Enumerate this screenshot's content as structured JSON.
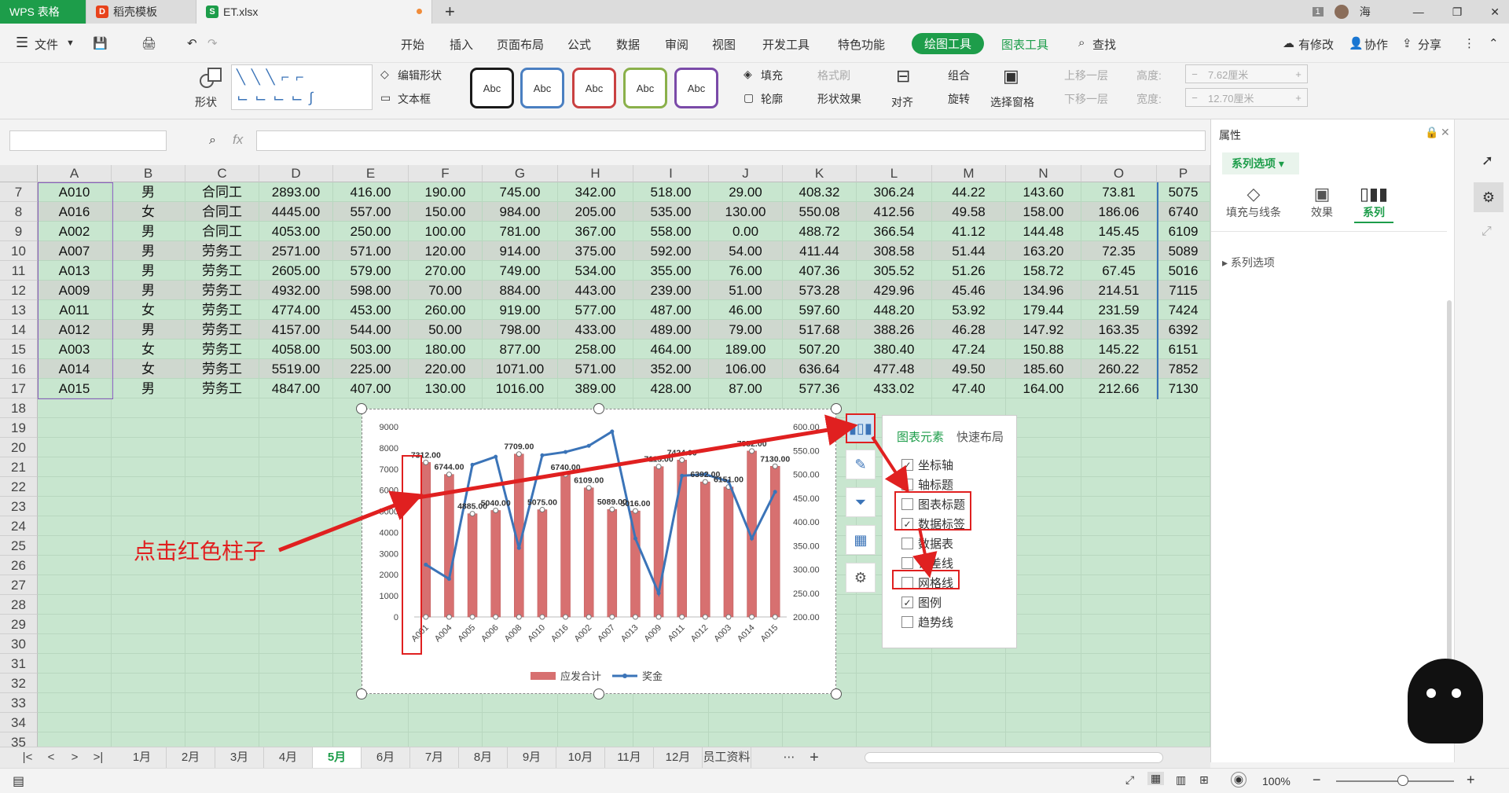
{
  "tabs": [
    {
      "label": "WPS 表格",
      "logo_color": "#c0392b"
    },
    {
      "label": "稻壳模板",
      "logo_color": "#e8421b"
    },
    {
      "label": "ET.xlsx",
      "logo_color": "#1d9d4a"
    }
  ],
  "title_area": {
    "badge": "1",
    "user": "海"
  },
  "menu": {
    "file": "文件",
    "items": [
      "开始",
      "插入",
      "页面布局",
      "公式",
      "数据",
      "审阅",
      "视图",
      "开发工具",
      "特色功能"
    ],
    "drawing_tools": "绘图工具",
    "chart_tools": "图表工具",
    "search": "查找",
    "modified": "有修改",
    "collab": "协作",
    "share": "分享"
  },
  "ribbon": {
    "shape": "形状",
    "edit_shape": "编辑形状",
    "textbox": "文本框",
    "styles": [
      "Abc",
      "Abc",
      "Abc",
      "Abc",
      "Abc"
    ],
    "style_colors": [
      "#1a1a1a",
      "#4a7fc1",
      "#c94040",
      "#8ab04a",
      "#7a4aa8"
    ],
    "fill": "填充",
    "format_brush": "格式刷",
    "outline": "轮廓",
    "shape_effect": "形状效果",
    "align": "对齐",
    "group": "组合",
    "rotate": "旋转",
    "select_pane": "选择窗格",
    "bring_up": "上移一层",
    "send_down": "下移一层",
    "height_label": "高度:",
    "height_value": "7.62厘米",
    "width_label": "宽度:",
    "width_value": "12.70厘米"
  },
  "formula": {
    "fx": "fx",
    "name_box": "",
    "content": ""
  },
  "columns": [
    "A",
    "B",
    "C",
    "D",
    "E",
    "F",
    "G",
    "H",
    "I",
    "J",
    "K",
    "L",
    "M",
    "N",
    "O",
    "P"
  ],
  "rows": [
    {
      "n": "7",
      "cells": [
        "A010",
        "男",
        "合同工",
        "2893.00",
        "416.00",
        "190.00",
        "745.00",
        "342.00",
        "518.00",
        "29.00",
        "408.32",
        "306.24",
        "44.22",
        "143.60",
        "73.81",
        "5075"
      ]
    },
    {
      "n": "8",
      "cells": [
        "A016",
        "女",
        "合同工",
        "4445.00",
        "557.00",
        "150.00",
        "984.00",
        "205.00",
        "535.00",
        "130.00",
        "550.08",
        "412.56",
        "49.58",
        "158.00",
        "186.06",
        "6740"
      ]
    },
    {
      "n": "9",
      "cells": [
        "A002",
        "男",
        "合同工",
        "4053.00",
        "250.00",
        "100.00",
        "781.00",
        "367.00",
        "558.00",
        "0.00",
        "488.72",
        "366.54",
        "41.12",
        "144.48",
        "145.45",
        "6109"
      ]
    },
    {
      "n": "10",
      "cells": [
        "A007",
        "男",
        "劳务工",
        "2571.00",
        "571.00",
        "120.00",
        "914.00",
        "375.00",
        "592.00",
        "54.00",
        "411.44",
        "308.58",
        "51.44",
        "163.20",
        "72.35",
        "5089"
      ]
    },
    {
      "n": "11",
      "cells": [
        "A013",
        "男",
        "劳务工",
        "2605.00",
        "579.00",
        "270.00",
        "749.00",
        "534.00",
        "355.00",
        "76.00",
        "407.36",
        "305.52",
        "51.26",
        "158.72",
        "67.45",
        "5016"
      ]
    },
    {
      "n": "12",
      "cells": [
        "A009",
        "男",
        "劳务工",
        "4932.00",
        "598.00",
        "70.00",
        "884.00",
        "443.00",
        "239.00",
        "51.00",
        "573.28",
        "429.96",
        "45.46",
        "134.96",
        "214.51",
        "7115"
      ]
    },
    {
      "n": "13",
      "cells": [
        "A011",
        "女",
        "劳务工",
        "4774.00",
        "453.00",
        "260.00",
        "919.00",
        "577.00",
        "487.00",
        "46.00",
        "597.60",
        "448.20",
        "53.92",
        "179.44",
        "231.59",
        "7424"
      ]
    },
    {
      "n": "14",
      "cells": [
        "A012",
        "男",
        "劳务工",
        "4157.00",
        "544.00",
        "50.00",
        "798.00",
        "433.00",
        "489.00",
        "79.00",
        "517.68",
        "388.26",
        "46.28",
        "147.92",
        "163.35",
        "6392"
      ]
    },
    {
      "n": "15",
      "cells": [
        "A003",
        "女",
        "劳务工",
        "4058.00",
        "503.00",
        "180.00",
        "877.00",
        "258.00",
        "464.00",
        "189.00",
        "507.20",
        "380.40",
        "47.24",
        "150.88",
        "145.22",
        "6151"
      ]
    },
    {
      "n": "16",
      "cells": [
        "A014",
        "女",
        "劳务工",
        "5519.00",
        "225.00",
        "220.00",
        "1071.00",
        "571.00",
        "352.00",
        "106.00",
        "636.64",
        "477.48",
        "49.50",
        "185.60",
        "260.22",
        "7852"
      ]
    },
    {
      "n": "17",
      "cells": [
        "A015",
        "男",
        "劳务工",
        "4847.00",
        "407.00",
        "130.00",
        "1016.00",
        "389.00",
        "428.00",
        "87.00",
        "577.36",
        "433.02",
        "47.40",
        "164.00",
        "212.66",
        "7130"
      ]
    }
  ],
  "empty_rows": [
    "18",
    "19",
    "20",
    "21",
    "22",
    "23",
    "24",
    "25",
    "26",
    "27",
    "28",
    "29",
    "30",
    "31",
    "32",
    "33",
    "34",
    "35"
  ],
  "chart_data": {
    "type": "bar",
    "categories": [
      "A001",
      "A004",
      "A005",
      "A006",
      "A008",
      "A010",
      "A016",
      "A002",
      "A007",
      "A013",
      "A009",
      "A011",
      "A012",
      "A003",
      "A014",
      "A015"
    ],
    "series": [
      {
        "name": "应发合计",
        "axis": "left",
        "values": [
          7312,
          6744,
          4885,
          5040,
          7709,
          5075,
          6740,
          6109,
          5089,
          5016,
          7115,
          7424,
          6392,
          6151,
          7852,
          7130
        ],
        "color": "#d77070"
      },
      {
        "name": "奖金",
        "axis": "right",
        "values": [
          310,
          280,
          520,
          537,
          345,
          540,
          547,
          560,
          590,
          365,
          250,
          497,
          500,
          485,
          365,
          463
        ],
        "color": "#3b74b8"
      }
    ],
    "y_left": {
      "min": 0,
      "max": 9000,
      "ticks": [
        "0",
        "1000",
        "2000",
        "3000",
        "4000",
        "5000",
        "6000",
        "7000",
        "8000",
        "9000"
      ]
    },
    "y_right": {
      "min": 200,
      "max": 600,
      "ticks": [
        "200.00",
        "250.00",
        "300.00",
        "350.00",
        "400.00",
        "450.00",
        "500.00",
        "550.00",
        "600.00"
      ]
    },
    "data_labels": [
      "7312.00",
      "6744.00",
      "4885.00",
      "5040.00",
      "7709.00",
      "5075.00",
      "6740.00",
      "6109.00",
      "5089.00",
      "5016.00",
      "7115.00",
      "7424.00",
      "6392.00",
      "6151.00",
      "7852.00",
      "7130.00"
    ],
    "legend": "bottom",
    "grid": false
  },
  "chart_elements": {
    "tab_elements": "图表元素",
    "tab_layout": "快速布局",
    "items": [
      {
        "label": "坐标轴",
        "checked": true
      },
      {
        "label": "轴标题",
        "checked": false
      },
      {
        "label": "图表标题",
        "checked": false
      },
      {
        "label": "数据标签",
        "checked": true
      },
      {
        "label": "数据表",
        "checked": false
      },
      {
        "label": "误差线",
        "checked": false
      },
      {
        "label": "网格线",
        "checked": false
      },
      {
        "label": "图例",
        "checked": true
      },
      {
        "label": "趋势线",
        "checked": false
      }
    ]
  },
  "annotation": "点击红色柱子",
  "properties": {
    "title": "属性",
    "series_options": "系列选项",
    "tabs": [
      "填充与线条",
      "效果",
      "系列"
    ],
    "section": "系列选项"
  },
  "sheet_tabs": [
    "1月",
    "2月",
    "3月",
    "4月",
    "5月",
    "6月",
    "7月",
    "8月",
    "9月",
    "10月",
    "11月",
    "12月",
    "员工资料"
  ],
  "active_sheet": "5月",
  "status": {
    "zoom": "100%"
  }
}
